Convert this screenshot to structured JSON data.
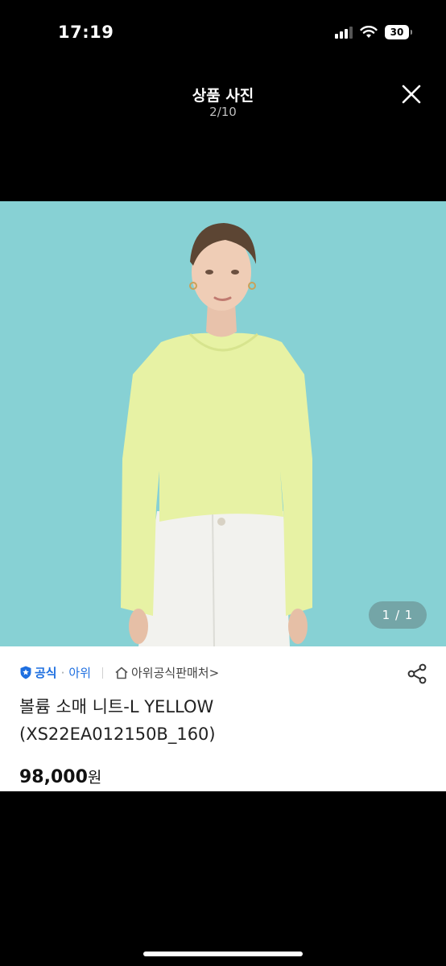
{
  "status_bar": {
    "time": "17:19",
    "battery": "30",
    "icons": [
      "signal-icon",
      "wifi-icon",
      "battery-icon"
    ]
  },
  "header": {
    "title": "상품 사진",
    "count": "2/10",
    "close_icon": "close-icon"
  },
  "photo": {
    "description_icon": "product-photo",
    "pager": "1 / 1",
    "background_color": "#87d1d4"
  },
  "product": {
    "official_label": "공식",
    "separator": "·",
    "brand": "아위",
    "store_label": "아위공식판매처",
    "store_chevron": ">",
    "title_line1": "볼륨 소매 니트-L YELLOW",
    "title_line2": "(XS22EA012150B_160)",
    "price": "98,000",
    "price_unit": "원",
    "share_icon": "share-icon"
  },
  "colors": {
    "accent": "#1e6fe0",
    "background": "#000000",
    "card": "#ffffff"
  }
}
